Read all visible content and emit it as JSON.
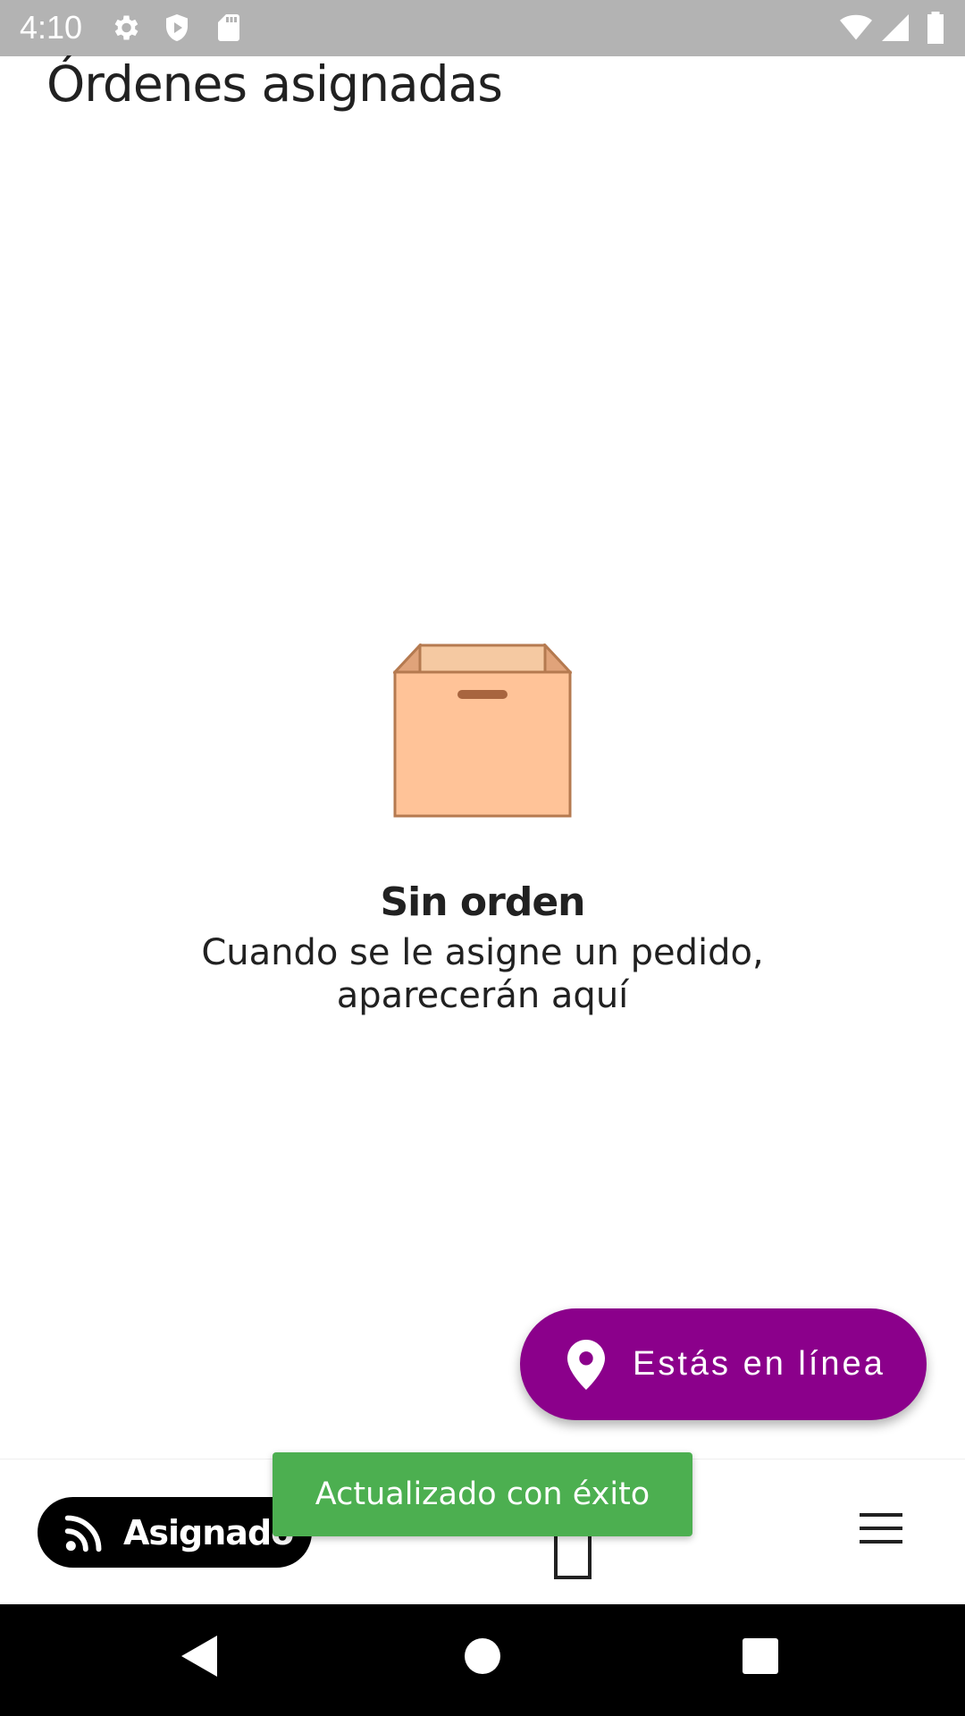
{
  "status_bar": {
    "time": "4:10",
    "left_icons": [
      "gear-icon",
      "shield-icon",
      "sd-card-icon"
    ],
    "right_icons": [
      "wifi-icon",
      "signal-icon",
      "battery-icon"
    ]
  },
  "header": {
    "title": "Órdenes asignadas"
  },
  "empty_state": {
    "icon": "empty-box-icon",
    "title": "Sin orden",
    "message": "Cuando se le asigne un pedido, aparecerán aquí"
  },
  "online_fab": {
    "icon": "location-pin-icon",
    "label": "Estás en línea",
    "color": "#8b008b"
  },
  "bottom_nav": {
    "assigned": {
      "icon": "rss-icon",
      "label": "Asignado"
    },
    "center_icon": "box-outline-icon",
    "menu_icon": "hamburger-menu-icon"
  },
  "toast": {
    "message": "Actualizado con éxito",
    "color": "#4caf50"
  },
  "system_nav": {
    "buttons": [
      "back-icon",
      "home-icon",
      "recents-icon"
    ]
  }
}
